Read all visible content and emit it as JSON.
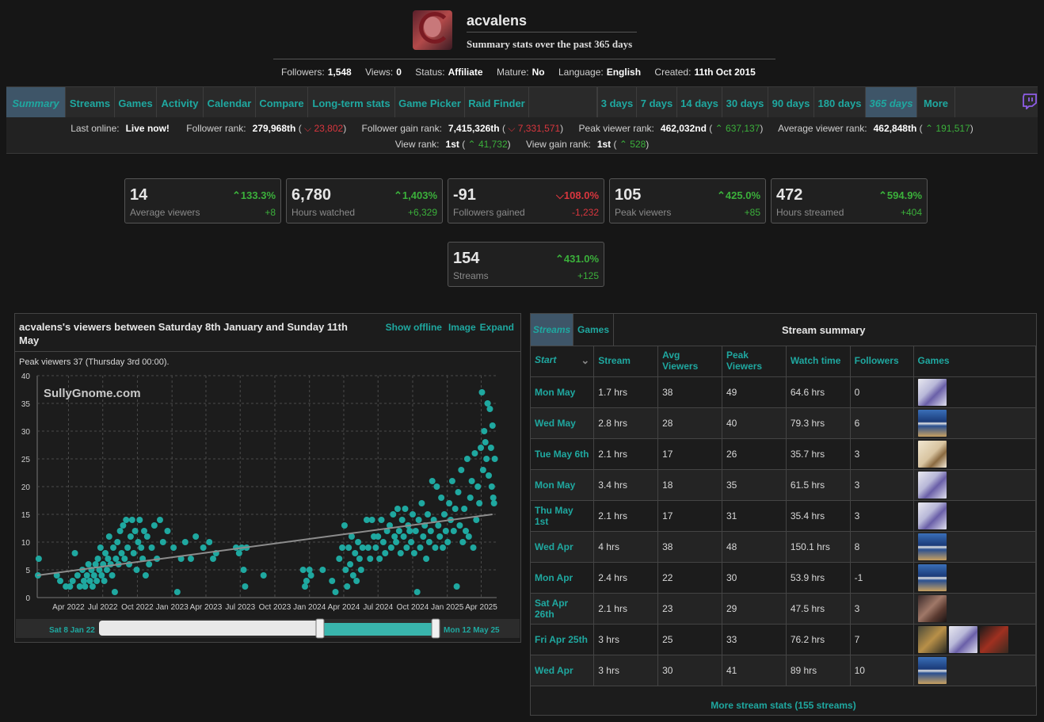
{
  "channel": {
    "name": "acvalens",
    "subtitle": "Summary stats over the past 365 days"
  },
  "stats": [
    {
      "key": "Followers:",
      "value": "1,548"
    },
    {
      "key": "Views:",
      "value": "0"
    },
    {
      "key": "Status:",
      "value": "Affiliate"
    },
    {
      "key": "Mature:",
      "value": "No"
    },
    {
      "key": "Language:",
      "value": "English"
    },
    {
      "key": "Created:",
      "value": "11th Oct 2015"
    }
  ],
  "nav": {
    "left": [
      "Summary",
      "Streams",
      "Games",
      "Activity",
      "Calendar",
      "Compare",
      "Long-term stats",
      "Game Picker",
      "Raid Finder"
    ],
    "right": [
      "3 days",
      "7 days",
      "14 days",
      "30 days",
      "90 days",
      "180 days",
      "365 days",
      "More"
    ],
    "active_left": "Summary",
    "active_right": "365 days"
  },
  "ranks": {
    "last_online_label": "Last online:",
    "last_online_value": "Live now!",
    "follower_rank_label": "Follower rank:",
    "follower_rank_value": "279,968th",
    "follower_rank_delta": "23,802",
    "follower_gain_label": "Follower gain rank:",
    "follower_gain_value": "7,415,326th",
    "follower_gain_delta": "7,331,571",
    "peak_viewer_label": "Peak viewer rank:",
    "peak_viewer_value": "462,032nd",
    "peak_viewer_delta": "637,137",
    "avg_viewer_label": "Average viewer rank:",
    "avg_viewer_value": "462,848th",
    "avg_viewer_delta": "191,517",
    "view_rank_label": "View rank:",
    "view_rank_value": "1st",
    "view_rank_delta": "41,732",
    "view_gain_label": "View gain rank:",
    "view_gain_value": "1st",
    "view_gain_delta": "528"
  },
  "cards": [
    {
      "value": "14",
      "label": "Average viewers",
      "pct": "133.3%",
      "delta": "+8",
      "dir": "up"
    },
    {
      "value": "6,780",
      "label": "Hours watched",
      "pct": "1,403%",
      "delta": "+6,329",
      "dir": "up"
    },
    {
      "value": "-91",
      "label": "Followers gained",
      "pct": "108.0%",
      "delta": "-1,232",
      "dir": "down"
    },
    {
      "value": "105",
      "label": "Peak viewers",
      "pct": "425.0%",
      "delta": "+85",
      "dir": "up"
    },
    {
      "value": "472",
      "label": "Hours streamed",
      "pct": "594.9%",
      "delta": "+404",
      "dir": "up"
    },
    {
      "value": "154",
      "label": "Streams",
      "pct": "431.0%",
      "delta": "+125",
      "dir": "up"
    }
  ],
  "chart_panel": {
    "title": "acvalens's viewers between Saturday 8th January and Sunday 11th May",
    "links": [
      "Show offline",
      "Image",
      "Expand"
    ],
    "peak_note": "Peak viewers 37 (Thursday 3rd 00:00).",
    "watermark": "SullyGnome.com",
    "range_start": "Sat 8 Jan 22",
    "range_end": "Mon 12 May 25"
  },
  "chart_data": {
    "type": "scatter",
    "ylim": [
      0,
      40
    ],
    "yticks": [
      0,
      5,
      10,
      15,
      20,
      25,
      30,
      35,
      40
    ],
    "xlim": [
      "2022-01-08",
      "2025-05-12"
    ],
    "xticks": [
      "Apr 2022",
      "Jul 2022",
      "Oct 2022",
      "Jan 2023",
      "Apr 2023",
      "Jul 2023",
      "Oct 2023",
      "Jan 2024",
      "Apr 2024",
      "Jul 2024",
      "Oct 2024",
      "Jan 2025",
      "Apr 2025"
    ],
    "trend": {
      "from": [
        "2022-01-08",
        4
      ],
      "to": [
        "2025-05-01",
        15
      ]
    },
    "colors": {
      "point": "#1fa8a0",
      "trend": "#8c8c8c",
      "grid": "#4a4a4a"
    },
    "points": [
      [
        "2022-01-12",
        7
      ],
      [
        "2022-01-10",
        4
      ],
      [
        "2022-03-01",
        4
      ],
      [
        "2022-03-10",
        3
      ],
      [
        "2022-03-25",
        2
      ],
      [
        "2022-04-05",
        2
      ],
      [
        "2022-04-12",
        3
      ],
      [
        "2022-04-18",
        8
      ],
      [
        "2022-04-25",
        4
      ],
      [
        "2022-05-01",
        2
      ],
      [
        "2022-05-08",
        5
      ],
      [
        "2022-05-12",
        3
      ],
      [
        "2022-05-15",
        2
      ],
      [
        "2022-05-20",
        4
      ],
      [
        "2022-05-24",
        6
      ],
      [
        "2022-05-28",
        3
      ],
      [
        "2022-06-01",
        5
      ],
      [
        "2022-06-04",
        2
      ],
      [
        "2022-06-08",
        4
      ],
      [
        "2022-06-12",
        6
      ],
      [
        "2022-06-15",
        3
      ],
      [
        "2022-06-18",
        7
      ],
      [
        "2022-06-22",
        5
      ],
      [
        "2022-06-25",
        9
      ],
      [
        "2022-06-28",
        4
      ],
      [
        "2022-07-02",
        6
      ],
      [
        "2022-07-05",
        3
      ],
      [
        "2022-07-08",
        8
      ],
      [
        "2022-07-12",
        5
      ],
      [
        "2022-07-15",
        7
      ],
      [
        "2022-07-18",
        11
      ],
      [
        "2022-07-22",
        6
      ],
      [
        "2022-07-26",
        4
      ],
      [
        "2022-07-29",
        9
      ],
      [
        "2022-08-02",
        1
      ],
      [
        "2022-08-05",
        7
      ],
      [
        "2022-08-09",
        10
      ],
      [
        "2022-08-12",
        6
      ],
      [
        "2022-08-16",
        12
      ],
      [
        "2022-08-20",
        8
      ],
      [
        "2022-08-24",
        13
      ],
      [
        "2022-08-28",
        7
      ],
      [
        "2022-09-01",
        14
      ],
      [
        "2022-09-05",
        9
      ],
      [
        "2022-09-09",
        6
      ],
      [
        "2022-09-13",
        11
      ],
      [
        "2022-09-17",
        14
      ],
      [
        "2022-09-21",
        8
      ],
      [
        "2022-09-25",
        12
      ],
      [
        "2022-09-29",
        5
      ],
      [
        "2022-10-03",
        10
      ],
      [
        "2022-10-07",
        14
      ],
      [
        "2022-10-11",
        9
      ],
      [
        "2022-10-15",
        7
      ],
      [
        "2022-10-19",
        12
      ],
      [
        "2022-10-23",
        4
      ],
      [
        "2022-10-27",
        11
      ],
      [
        "2022-11-01",
        6
      ],
      [
        "2022-11-08",
        9
      ],
      [
        "2022-11-15",
        13
      ],
      [
        "2022-11-22",
        7
      ],
      [
        "2022-11-30",
        14
      ],
      [
        "2022-12-08",
        10
      ],
      [
        "2022-12-20",
        12
      ],
      [
        "2023-01-05",
        9
      ],
      [
        "2023-01-15",
        1
      ],
      [
        "2023-01-25",
        7
      ],
      [
        "2023-02-05",
        10
      ],
      [
        "2023-02-20",
        7
      ],
      [
        "2023-03-05",
        11
      ],
      [
        "2023-03-25",
        9
      ],
      [
        "2023-04-10",
        10
      ],
      [
        "2023-04-20",
        7
      ],
      [
        "2023-04-28",
        8
      ],
      [
        "2023-06-20",
        9
      ],
      [
        "2023-06-28",
        8
      ],
      [
        "2023-07-05",
        9
      ],
      [
        "2023-07-10",
        5
      ],
      [
        "2023-07-14",
        2
      ],
      [
        "2023-07-18",
        9
      ],
      [
        "2023-09-01",
        4
      ],
      [
        "2023-12-15",
        5
      ],
      [
        "2023-12-20",
        2
      ],
      [
        "2023-12-24",
        3
      ],
      [
        "2024-01-01",
        5
      ],
      [
        "2024-01-05",
        4
      ],
      [
        "2024-02-05",
        5
      ],
      [
        "2024-03-01",
        3
      ],
      [
        "2024-03-10",
        1
      ],
      [
        "2024-03-20",
        7
      ],
      [
        "2024-03-28",
        9
      ],
      [
        "2024-04-03",
        13
      ],
      [
        "2024-04-06",
        5
      ],
      [
        "2024-04-10",
        2
      ],
      [
        "2024-04-14",
        9
      ],
      [
        "2024-04-18",
        6
      ],
      [
        "2024-04-22",
        11
      ],
      [
        "2024-04-26",
        4
      ],
      [
        "2024-05-01",
        8
      ],
      [
        "2024-05-05",
        3
      ],
      [
        "2024-05-09",
        10
      ],
      [
        "2024-05-13",
        7
      ],
      [
        "2024-05-17",
        5
      ],
      [
        "2024-05-21",
        9
      ],
      [
        "2024-06-01",
        14
      ],
      [
        "2024-06-05",
        9
      ],
      [
        "2024-06-10",
        7
      ],
      [
        "2024-06-15",
        14
      ],
      [
        "2024-06-20",
        11
      ],
      [
        "2024-06-25",
        9
      ],
      [
        "2024-07-01",
        11
      ],
      [
        "2024-07-05",
        7
      ],
      [
        "2024-07-10",
        14
      ],
      [
        "2024-07-15",
        10
      ],
      [
        "2024-07-20",
        8
      ],
      [
        "2024-07-25",
        12
      ],
      [
        "2024-08-01",
        13
      ],
      [
        "2024-08-05",
        9
      ],
      [
        "2024-08-10",
        15
      ],
      [
        "2024-08-14",
        11
      ],
      [
        "2024-08-18",
        10
      ],
      [
        "2024-08-22",
        16
      ],
      [
        "2024-08-26",
        12
      ],
      [
        "2024-08-30",
        8
      ],
      [
        "2024-09-03",
        14
      ],
      [
        "2024-09-07",
        11
      ],
      [
        "2024-09-11",
        16
      ],
      [
        "2024-09-15",
        9
      ],
      [
        "2024-09-19",
        13
      ],
      [
        "2024-09-23",
        12
      ],
      [
        "2024-09-27",
        10
      ],
      [
        "2024-10-01",
        15
      ],
      [
        "2024-10-05",
        8
      ],
      [
        "2024-10-09",
        12
      ],
      [
        "2024-10-13",
        1
      ],
      [
        "2024-10-17",
        14
      ],
      [
        "2024-10-21",
        9
      ],
      [
        "2024-10-25",
        17
      ],
      [
        "2024-10-29",
        11
      ],
      [
        "2024-11-02",
        13
      ],
      [
        "2024-11-06",
        7
      ],
      [
        "2024-11-10",
        15
      ],
      [
        "2024-11-14",
        10
      ],
      [
        "2024-11-18",
        12
      ],
      [
        "2024-11-22",
        21
      ],
      [
        "2024-11-26",
        14
      ],
      [
        "2024-11-30",
        9
      ],
      [
        "2024-12-04",
        20
      ],
      [
        "2024-12-08",
        13
      ],
      [
        "2024-12-12",
        11
      ],
      [
        "2024-12-16",
        18
      ],
      [
        "2024-12-20",
        9
      ],
      [
        "2024-12-24",
        15
      ],
      [
        "2024-12-28",
        12
      ],
      [
        "2025-01-02",
        10
      ],
      [
        "2025-01-06",
        17
      ],
      [
        "2025-01-10",
        14
      ],
      [
        "2025-01-14",
        21
      ],
      [
        "2025-01-18",
        12
      ],
      [
        "2025-01-22",
        16
      ],
      [
        "2025-01-26",
        2
      ],
      [
        "2025-01-30",
        19
      ],
      [
        "2025-02-03",
        13
      ],
      [
        "2025-02-07",
        23
      ],
      [
        "2025-02-11",
        10
      ],
      [
        "2025-02-15",
        16
      ],
      [
        "2025-02-19",
        12
      ],
      [
        "2025-02-23",
        25
      ],
      [
        "2025-02-27",
        11
      ],
      [
        "2025-03-03",
        18
      ],
      [
        "2025-03-07",
        21
      ],
      [
        "2025-03-11",
        9
      ],
      [
        "2025-03-15",
        26
      ],
      [
        "2025-03-19",
        14
      ],
      [
        "2025-03-23",
        20
      ],
      [
        "2025-03-27",
        17
      ],
      [
        "2025-03-31",
        27
      ],
      [
        "2025-04-03",
        37
      ],
      [
        "2025-04-06",
        23
      ],
      [
        "2025-04-09",
        30
      ],
      [
        "2025-04-12",
        28
      ],
      [
        "2025-04-15",
        25
      ],
      [
        "2025-04-18",
        35
      ],
      [
        "2025-04-21",
        22
      ],
      [
        "2025-04-24",
        34
      ],
      [
        "2025-04-27",
        27
      ],
      [
        "2025-04-29",
        20
      ],
      [
        "2025-05-01",
        31
      ],
      [
        "2025-05-03",
        18
      ],
      [
        "2025-05-05",
        17
      ],
      [
        "2025-05-07",
        25
      ]
    ]
  },
  "table": {
    "tabs": [
      "Streams",
      "Games"
    ],
    "title": "Stream summary",
    "columns": [
      "Start",
      "Stream",
      "Avg Viewers",
      "Peak Viewers",
      "Watch time",
      "Followers",
      "Games"
    ],
    "rows": [
      {
        "start": "Mon May",
        "stream": "1.7 hrs",
        "avg": "38",
        "peak": "49",
        "watch": "64.6 hrs",
        "followers": "0",
        "games": [
          "valorant"
        ]
      },
      {
        "start": "Wed May",
        "stream": "2.8 hrs",
        "avg": "28",
        "peak": "40",
        "watch": "79.3 hrs",
        "followers": "6",
        "games": [
          "vrchat"
        ]
      },
      {
        "start": "Tue May 6th",
        "stream": "2.1 hrs",
        "avg": "17",
        "peak": "26",
        "watch": "35.7 hrs",
        "followers": "3",
        "games": [
          "light"
        ]
      },
      {
        "start": "Mon May",
        "stream": "3.4 hrs",
        "avg": "18",
        "peak": "35",
        "watch": "61.5 hrs",
        "followers": "3",
        "games": [
          "valorant"
        ]
      },
      {
        "start": "Thu May 1st",
        "stream": "2.1 hrs",
        "avg": "17",
        "peak": "31",
        "watch": "35.4 hrs",
        "followers": "3",
        "games": [
          "valorant"
        ]
      },
      {
        "start": "Wed Apr",
        "stream": "4 hrs",
        "avg": "38",
        "peak": "48",
        "watch": "150.1 hrs",
        "followers": "8",
        "games": [
          "vrchat"
        ]
      },
      {
        "start": "Mon Apr",
        "stream": "2.4 hrs",
        "avg": "22",
        "peak": "30",
        "watch": "53.9 hrs",
        "followers": "-1",
        "games": [
          "vrchat"
        ]
      },
      {
        "start": "Sat Apr 26th",
        "stream": "2.1 hrs",
        "avg": "23",
        "peak": "29",
        "watch": "47.5 hrs",
        "followers": "3",
        "games": [
          "dark"
        ]
      },
      {
        "start": "Fri Apr 25th",
        "stream": "3 hrs",
        "avg": "25",
        "peak": "33",
        "watch": "76.2 hrs",
        "followers": "7",
        "games": [
          "shooter",
          "valorant",
          "red"
        ]
      },
      {
        "start": "Wed Apr",
        "stream": "3 hrs",
        "avg": "30",
        "peak": "41",
        "watch": "89 hrs",
        "followers": "10",
        "games": [
          "vrchat"
        ]
      }
    ],
    "footer": "More stream stats (155 streams)"
  }
}
